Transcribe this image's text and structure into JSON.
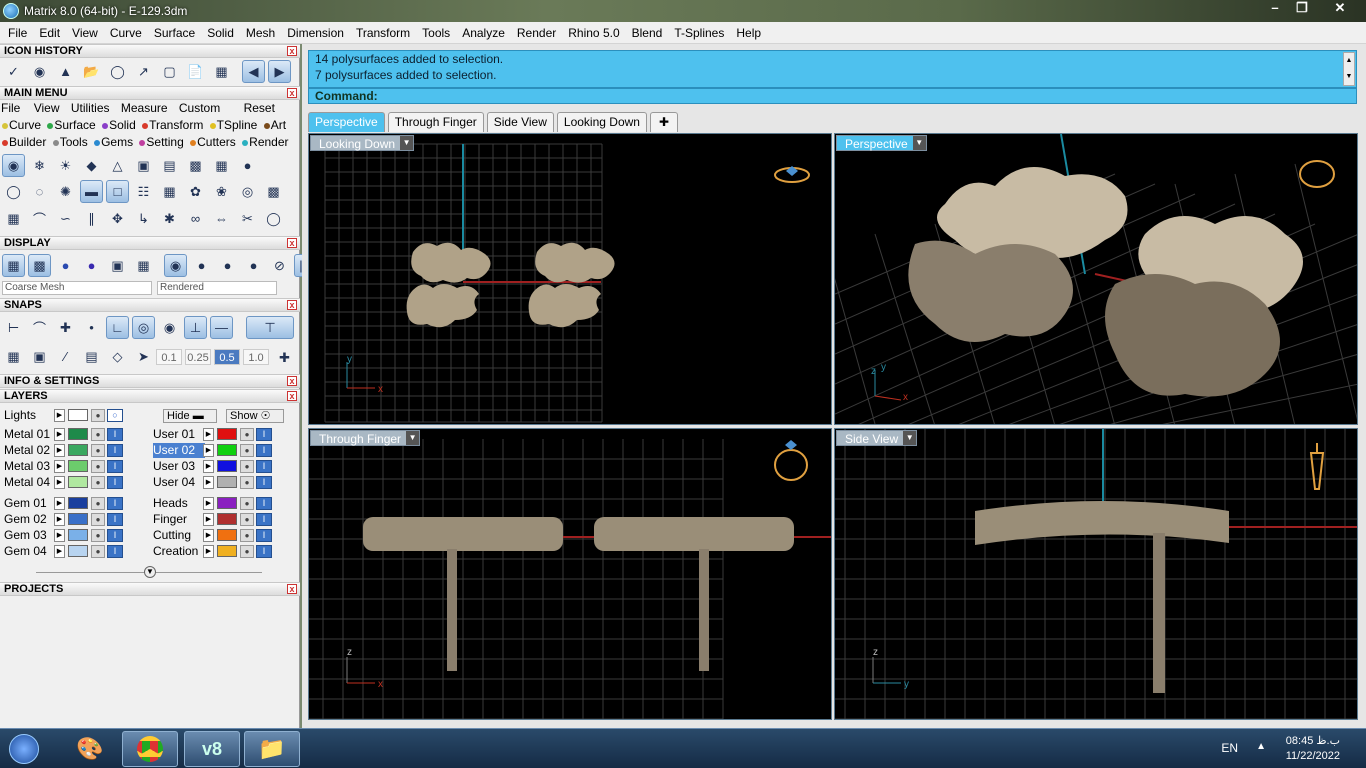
{
  "title": "Matrix 8.0 (64-bit) - E-129.3dm",
  "menus": [
    "File",
    "Edit",
    "View",
    "Curve",
    "Surface",
    "Solid",
    "Mesh",
    "Dimension",
    "Transform",
    "Tools",
    "Analyze",
    "Render",
    "Rhino 5.0",
    "Blend",
    "T-Splines",
    "Help"
  ],
  "panels": {
    "icon_history": "ICON HISTORY",
    "main_menu": "MAIN MENU",
    "display": "DISPLAY",
    "snaps": "SNAPS",
    "info": "INFO & SETTINGS",
    "layers": "LAYERS",
    "projects": "PROJECTS"
  },
  "main_menu_row1": [
    "File",
    "View",
    "Utilities",
    "Measure",
    "Custom",
    "Reset"
  ],
  "main_menu_row2": [
    {
      "label": "Curve",
      "color": "#d6c43a"
    },
    {
      "label": "Surface",
      "color": "#2fa84a"
    },
    {
      "label": "Solid",
      "color": "#8a3ec8"
    },
    {
      "label": "Transform",
      "color": "#d83a2a"
    },
    {
      "label": "TSpline",
      "color": "#e0c020"
    },
    {
      "label": "Art",
      "color": "#7a4a1a"
    }
  ],
  "main_menu_row3": [
    {
      "label": "Builder",
      "color": "#d83a2a"
    },
    {
      "label": "Tools",
      "color": "#8a8a8a"
    },
    {
      "label": "Gems",
      "color": "#2a8ad0"
    },
    {
      "label": "Setting",
      "color": "#c040a0"
    },
    {
      "label": "Cutters",
      "color": "#e08020"
    },
    {
      "label": "Render",
      "color": "#2ab0c0"
    }
  ],
  "display": {
    "mesh": "Coarse Mesh",
    "mode": "Rendered"
  },
  "snap_values": [
    "0.1",
    "0.25",
    "0.5",
    "1.0"
  ],
  "layers": {
    "lights_label": "Lights",
    "hide_label": "Hide",
    "show_label": "Show",
    "left": [
      {
        "name": "Metal 01",
        "color": "#1e8a4a"
      },
      {
        "name": "Metal 02",
        "color": "#3aa860"
      },
      {
        "name": "Metal 03",
        "color": "#6ccc6c"
      },
      {
        "name": "Metal 04",
        "color": "#b0e8a0"
      },
      {
        "name": "Gem 01",
        "color": "#1a3f9e"
      },
      {
        "name": "Gem 02",
        "color": "#3a70c8"
      },
      {
        "name": "Gem 03",
        "color": "#7ab0e8"
      },
      {
        "name": "Gem 04",
        "color": "#b8d4f0"
      }
    ],
    "right": [
      {
        "name": "User 01",
        "color": "#e01010"
      },
      {
        "name": "User 02",
        "color": "#10d010"
      },
      {
        "name": "User 03",
        "color": "#1010e0"
      },
      {
        "name": "User 04",
        "color": "#b0b0b0"
      },
      {
        "name": "Heads",
        "color": "#8a20c0"
      },
      {
        "name": "Finger",
        "color": "#b03030"
      },
      {
        "name": "Cutting",
        "color": "#f07010"
      },
      {
        "name": "Creation",
        "color": "#f0b020"
      }
    ]
  },
  "command": {
    "history": [
      "14 polysurfaces added to selection.",
      "7 polysurfaces added to selection."
    ],
    "prompt": "Command:"
  },
  "tabs": [
    "Perspective",
    "Through Finger",
    "Side View",
    "Looking Down"
  ],
  "viewports": {
    "top_left": "Looking Down",
    "top_right": "Perspective",
    "bottom_left": "Through Finger",
    "bottom_right": "Side View"
  },
  "axes": {
    "x": "x",
    "y": "y",
    "z": "z"
  },
  "taskbar": {
    "lang": "EN",
    "time": "08:45 ب.ظ",
    "date": "11/22/2022"
  }
}
